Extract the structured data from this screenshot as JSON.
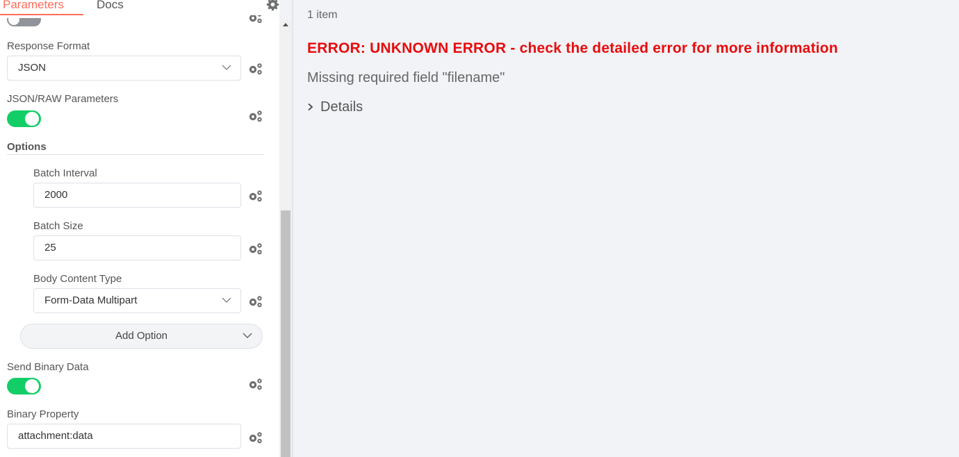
{
  "tabs": {
    "parameters": "Parameters",
    "docs": "Docs"
  },
  "response_format": {
    "label": "Response Format",
    "value": "JSON"
  },
  "json_raw": {
    "label": "JSON/RAW Parameters",
    "enabled": true
  },
  "options": {
    "title": "Options",
    "batch_interval": {
      "label": "Batch Interval",
      "value": "2000"
    },
    "batch_size": {
      "label": "Batch Size",
      "value": "25"
    },
    "body_content_type": {
      "label": "Body Content Type",
      "value": "Form-Data Multipart"
    },
    "add_option": "Add Option"
  },
  "send_binary": {
    "label": "Send Binary Data",
    "enabled": true
  },
  "binary_property": {
    "label": "Binary Property",
    "value": "attachment:data"
  },
  "output": {
    "item_count": "1 item",
    "error_title": "ERROR: UNKNOWN ERROR - check the detailed error for more information",
    "error_message": "Missing required field \"filename\"",
    "details": "Details"
  },
  "colors": {
    "accent": "#ff6d5a",
    "toggle_on": "#13ce66",
    "error": "#e80c0c"
  }
}
